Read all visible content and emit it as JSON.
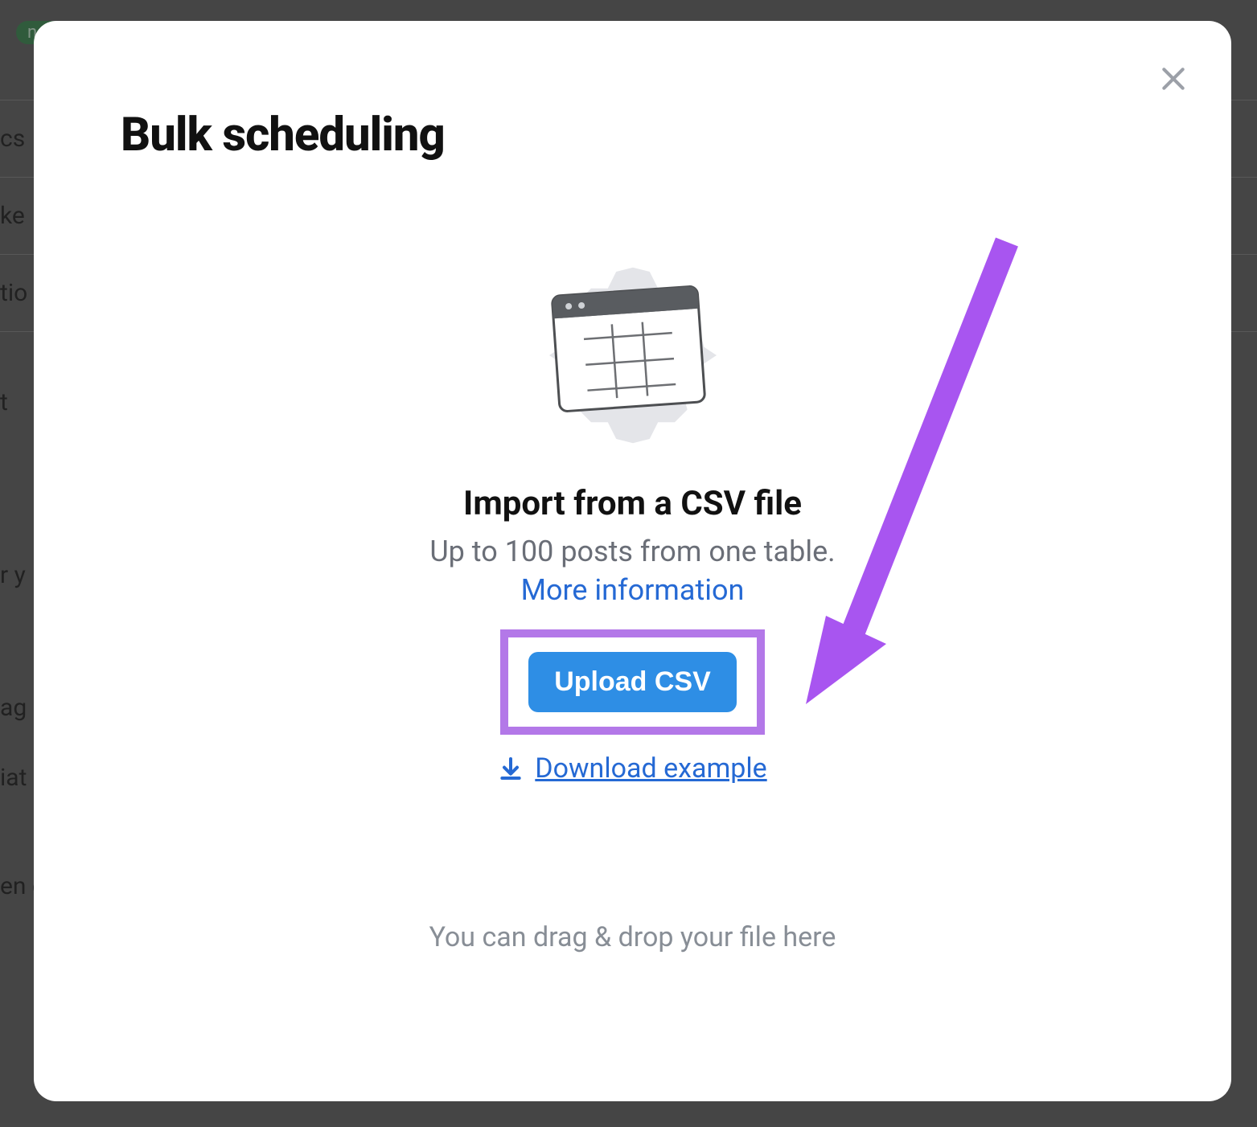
{
  "background": {
    "badge": "new",
    "row_fragments": [
      "cs",
      "ke",
      "tio",
      "t",
      "r y",
      "ag",
      "iat",
      "en our new"
    ]
  },
  "modal": {
    "title": "Bulk scheduling",
    "import": {
      "heading": "Import from a CSV file",
      "subtext": "Up to 100 posts from one table.",
      "more_info": "More information",
      "upload_button": "Upload CSV",
      "download_example": "Download example",
      "drag_drop": "You can drag & drop your file here"
    }
  },
  "annotation": {
    "highlight_color": "#b378e8",
    "arrow_color": "#a855f0"
  }
}
